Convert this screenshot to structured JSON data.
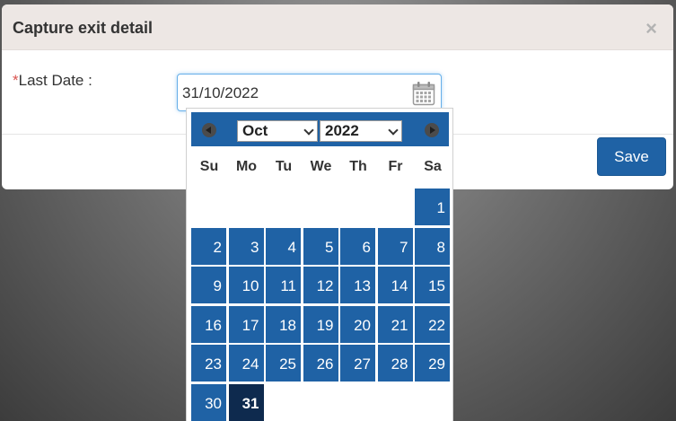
{
  "modal": {
    "title": "Capture exit detail",
    "close_glyph": "×",
    "field": {
      "required_mark": "*",
      "label": "Last Date :",
      "value": "31/10/2022",
      "icon": "calendar-icon"
    },
    "save_label": "Save"
  },
  "datepicker": {
    "month": "Oct",
    "year": "2022",
    "weekdays": [
      "Su",
      "Mo",
      "Tu",
      "We",
      "Th",
      "Fr",
      "Sa"
    ],
    "days": [
      "1",
      "2",
      "3",
      "4",
      "5",
      "6",
      "7",
      "8",
      "9",
      "10",
      "11",
      "12",
      "13",
      "14",
      "15",
      "16",
      "17",
      "18",
      "19",
      "20",
      "21",
      "22",
      "23",
      "24",
      "25",
      "26",
      "27",
      "28",
      "29",
      "30",
      "31"
    ],
    "first_weekday_index": 6,
    "selected_day": "31",
    "colors": {
      "accent": "#1f62a5",
      "selected": "#0e2a4e",
      "nav_arrow": "#4b4b4b"
    }
  }
}
